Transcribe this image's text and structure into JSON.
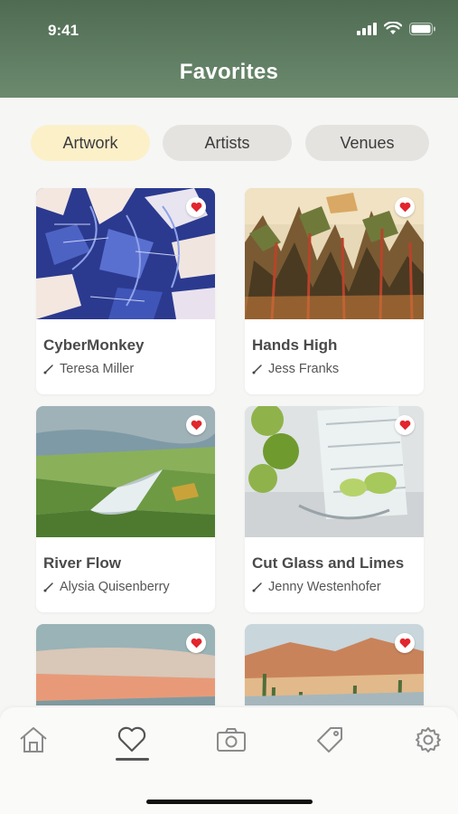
{
  "status": {
    "time": "9:41"
  },
  "header": {
    "title": "Favorites"
  },
  "tabs": [
    {
      "label": "Artwork",
      "active": true
    },
    {
      "label": "Artists",
      "active": false
    },
    {
      "label": "Venues",
      "active": false
    }
  ],
  "cards": [
    {
      "title": "CyberMonkey",
      "artist": "Teresa Miller",
      "favorited": true
    },
    {
      "title": "Hands High",
      "artist": "Jess Franks",
      "favorited": true
    },
    {
      "title": "River Flow",
      "artist": "Alysia Quisenberry",
      "favorited": true
    },
    {
      "title": "Cut Glass and Limes",
      "artist": "Jenny Westenhofer",
      "favorited": true
    },
    {
      "favorited": true
    },
    {
      "favorited": true
    }
  ],
  "nav": {
    "items": [
      {
        "icon": "home-icon",
        "active": false
      },
      {
        "icon": "heart-icon",
        "active": true
      },
      {
        "icon": "camera-icon",
        "active": false
      },
      {
        "icon": "tag-icon",
        "active": false
      },
      {
        "icon": "gear-icon",
        "active": false
      }
    ]
  },
  "colors": {
    "header": "#5d7a61",
    "active_tab": "#fcf0c9",
    "heart": "#e2262d"
  }
}
